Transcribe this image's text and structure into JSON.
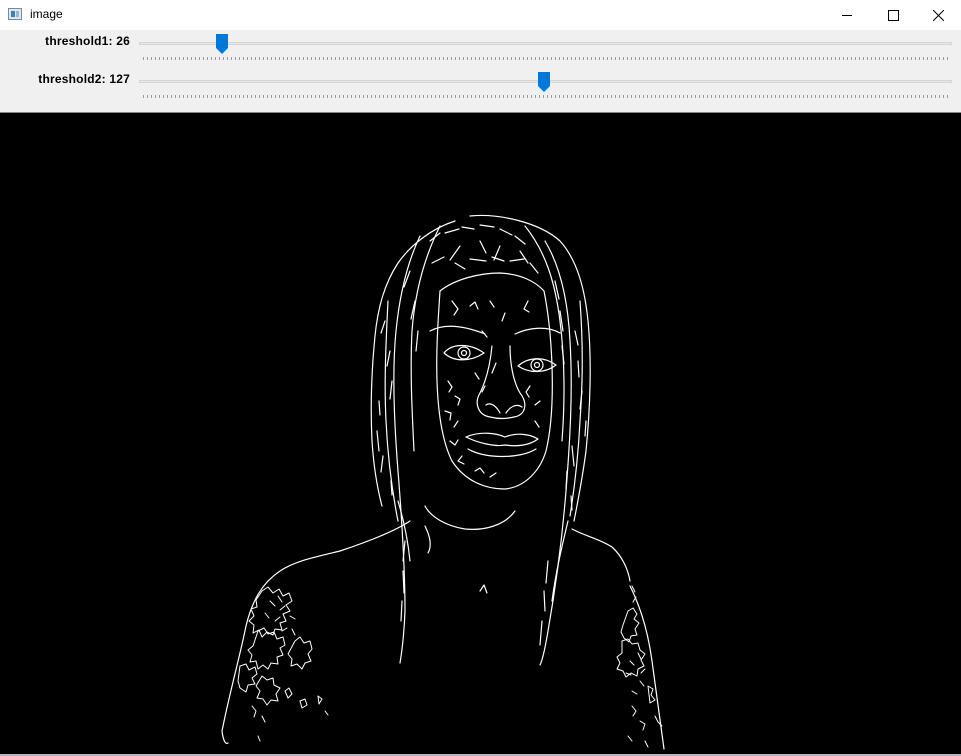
{
  "window": {
    "title": "image",
    "icon": "opencv-window-icon",
    "controls": [
      "minimize-icon",
      "maximize-icon",
      "close-icon"
    ]
  },
  "trackbars": [
    {
      "label": "threshold1: 26",
      "value": 26,
      "max": 255
    },
    {
      "label": "threshold2: 127",
      "value": 127,
      "max": 255
    }
  ],
  "colors": {
    "thumb": "#0078d7",
    "canvas_bg": "#000000",
    "edges": "#ffffff"
  },
  "canvas": {
    "content": "canny-edge-portrait"
  }
}
